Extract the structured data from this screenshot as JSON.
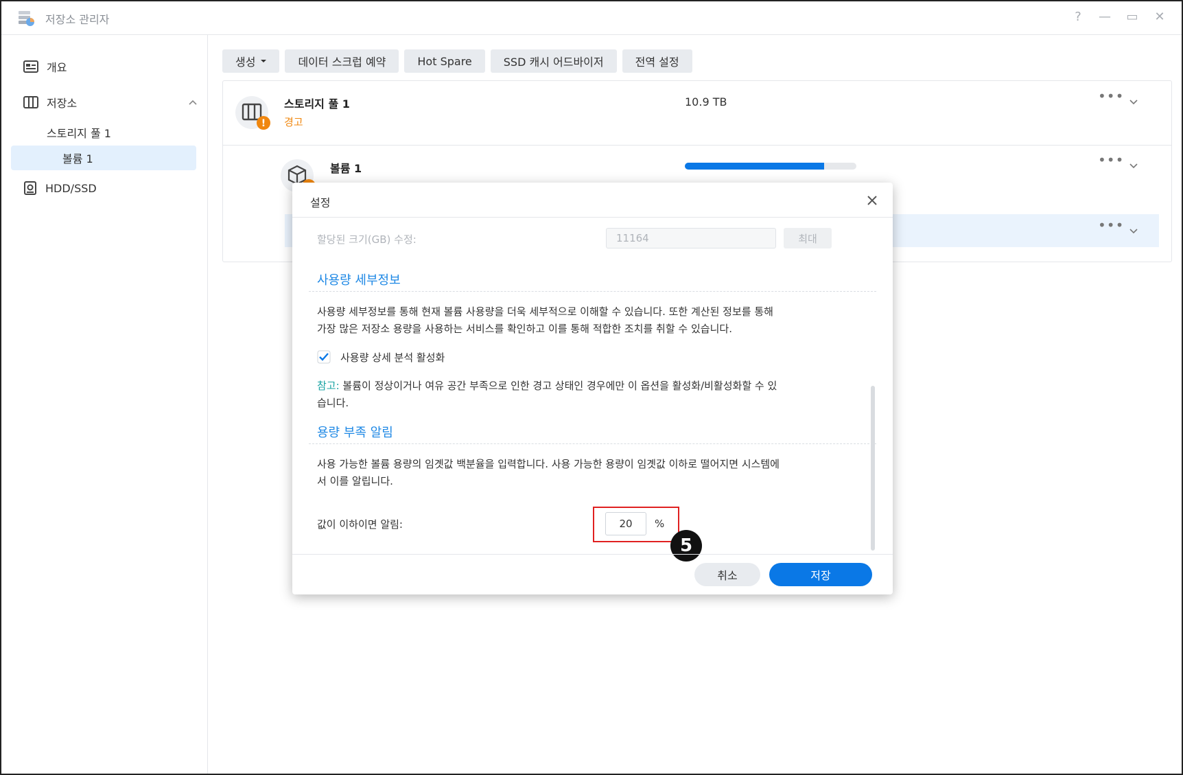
{
  "window": {
    "title": "저장소 관리자",
    "controls": [
      "?",
      "—",
      "▭",
      "✕"
    ]
  },
  "sidebar": {
    "items": [
      {
        "label": "개요",
        "icon": "overview-icon"
      },
      {
        "label": "저장소",
        "icon": "storage-icon",
        "expanded": true
      },
      {
        "label": "스토리지 풀 1"
      },
      {
        "label": "볼륨 1",
        "active": true
      },
      {
        "label": "HDD/SSD",
        "icon": "drive-icon"
      }
    ]
  },
  "toolbar": {
    "buttons": [
      "생성",
      "데이터 스크럽 예약",
      "Hot Spare",
      "SSD 캐시 어드바이저",
      "전역 설정"
    ]
  },
  "pool": {
    "name": "스토리지 풀 1",
    "status": "경고",
    "size": "10.9 TB"
  },
  "volume": {
    "name": "볼륨 1",
    "usage_fraction": 0.81
  },
  "colors": {
    "accent": "#0a78e6",
    "warning": "#f0870f",
    "section": "#1e88e5",
    "highlight": "#e02020"
  },
  "dialog": {
    "title": "설정",
    "allocated_label": "할당된 크기(GB) 수정:",
    "allocated_value": "11164",
    "max_label": "최대",
    "usage_section_title": "사용량 세부정보",
    "usage_desc_1": "사용량 세부정보를 통해 현재 볼륨 사용량을 더욱 세부적으로 이해할 수 있습니다. 또한 계산된 정보를 통해",
    "usage_desc_2": "가장 많은 저장소 용량을 사용하는 서비스를 확인하고 이를 통해 적합한 조치를 취할 수 있습니다.",
    "usage_checkbox_label": "사용량 상세 분석 활성화",
    "usage_checkbox_checked": true,
    "note_prefix": "참고:",
    "note_text_1": " 볼륨이 정상이거나 여유 공간 부족으로 인한 경고 상태인 경우에만 이 옵션을 활성화/비활성화할 수 있",
    "note_text_2": "습니다.",
    "lowcap_section_title": "용량 부족 알림",
    "lowcap_desc_1": "사용 가능한 볼륨 용량의 임곗값 백분율을 입력합니다. 사용 가능한 용량이 임곗값 이하로 떨어지면 시스템에",
    "lowcap_desc_2": "서 이를 알립니다.",
    "threshold_label": "값이 이하이면 알림:",
    "threshold_value": "20",
    "threshold_unit": "%",
    "step_number": "5",
    "cancel_label": "취소",
    "save_label": "저장"
  }
}
